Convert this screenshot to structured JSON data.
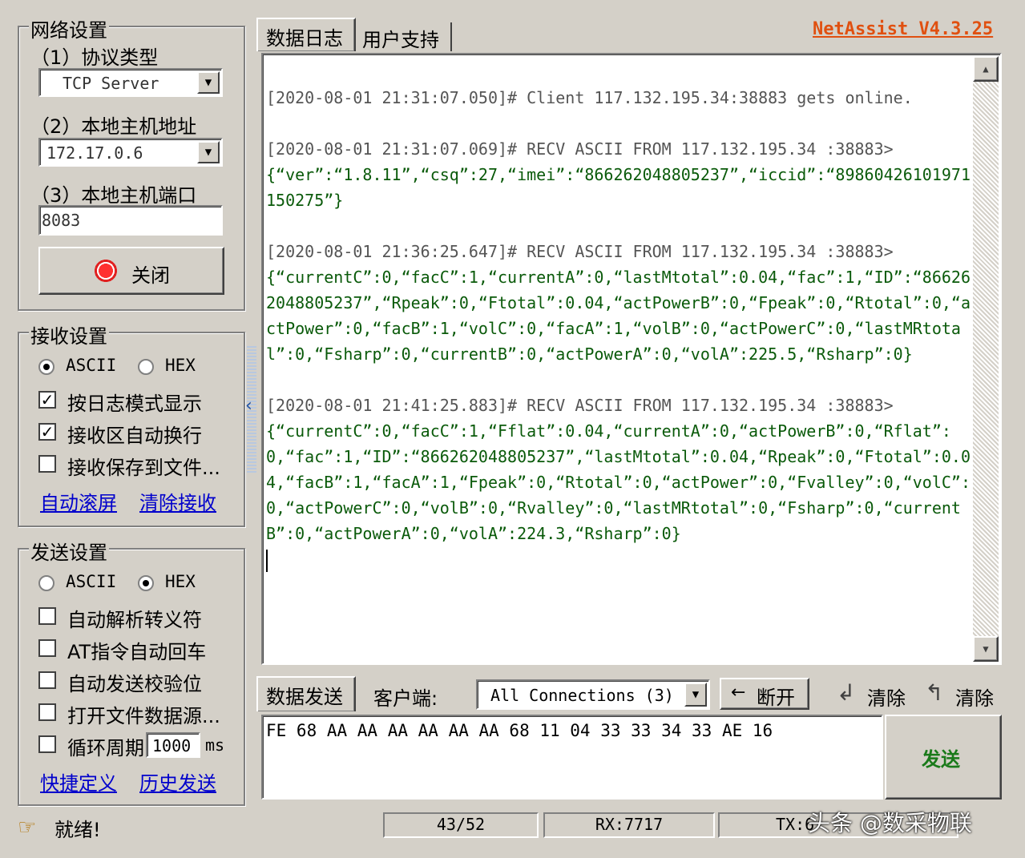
{
  "app": {
    "title": "NetAssist V4.3.25",
    "status": "就绪!"
  },
  "network": {
    "title": "网络设置",
    "protocol_label": "（1）协议类型",
    "protocol_value": "TCP Server",
    "host_label": "（2）本地主机地址",
    "host_value": "172.17.0.6",
    "port_label": "（3）本地主机端口",
    "port_value": "8083",
    "close_button": "关闭"
  },
  "receive": {
    "title": "接收设置",
    "ascii": "ASCII",
    "hex": "HEX",
    "log_mode": "按日志模式显示",
    "auto_wrap": "接收区自动换行",
    "save_file": "接收保存到文件...",
    "auto_scroll": "自动滚屏",
    "clear_recv": "清除接收"
  },
  "send": {
    "title": "发送设置",
    "ascii": "ASCII",
    "hex": "HEX",
    "auto_escape": "自动解析转义符",
    "at_enter": "AT指令自动回车",
    "auto_checksum": "自动发送校验位",
    "open_file": "打开文件数据源...",
    "loop": "循环周期",
    "loop_value": "1000",
    "loop_unit": "ms",
    "shortcut": "快捷定义",
    "history": "历史发送"
  },
  "tabs": {
    "data_log": "数据日志",
    "user_support": "用户支持"
  },
  "log": [
    {
      "header": "[2020-08-01 21:31:07.050]# Client 117.132.195.34:38883 gets online.",
      "body": ""
    },
    {
      "header": "[2020-08-01 21:31:07.069]# RECV ASCII FROM 117.132.195.34 :38883>",
      "body": "{“ver”:“1.8.11”,“csq”:27,“imei”:“866262048805237”,“iccid”:“89860426101971150275”}"
    },
    {
      "header": "[2020-08-01 21:36:25.647]# RECV ASCII FROM 117.132.195.34 :38883>",
      "body": "{“currentC”:0,“facC”:1,“currentA”:0,“lastMtotal”:0.04,“fac”:1,“ID”:“866262048805237”,“Rpeak”:0,“Ftotal”:0.04,“actPowerB”:0,“Fpeak”:0,“Rtotal”:0,“actPower”:0,“facB”:1,“volC”:0,“facA”:1,“volB”:0,“actPowerC”:0,“lastMRtotal”:0,“Fsharp”:0,“currentB”:0,“actPowerA”:0,“volA”:225.5,“Rsharp”:0}"
    },
    {
      "header": "[2020-08-01 21:41:25.883]# RECV ASCII FROM 117.132.195.34 :38883>",
      "body": "{“currentC”:0,“facC”:1,“Fflat”:0.04,“currentA”:0,“actPowerB”:0,“Rflat”:0,“fac”:1,“ID”:“866262048805237”,“lastMtotal”:0.04,“Rpeak”:0,“Ftotal”:0.04,“facB”:1,“facA”:1,“Fpeak”:0,“Rtotal”:0,“actPower”:0,“Fvalley”:0,“volC”:0,“actPowerC”:0,“volB”:0,“Rvalley”:0,“lastMRtotal”:0,“Fsharp”:0,“currentB”:0,“actPowerA”:0,“volA”:224.3,“Rsharp”:0}"
    }
  ],
  "sendbar": {
    "tab": "数据发送",
    "client_label": "客户端:",
    "client_value": "All Connections (3)",
    "disconnect": "断开",
    "clear1": "清除",
    "clear2": "清除",
    "send_button": "发送"
  },
  "send_input": "FE 68 AA AA AA AA AA AA 68 11 04 33 33 34 33 AE 16",
  "statusbar": {
    "count": "43/52",
    "rx": "RX:7717",
    "tx": "TX:6"
  },
  "watermark": "头条 @数采物联",
  "colors": {
    "title": "#e05010",
    "log_body": "#0a5a0a",
    "send_btn": "#1a7a1a",
    "link": "#0000cc"
  }
}
